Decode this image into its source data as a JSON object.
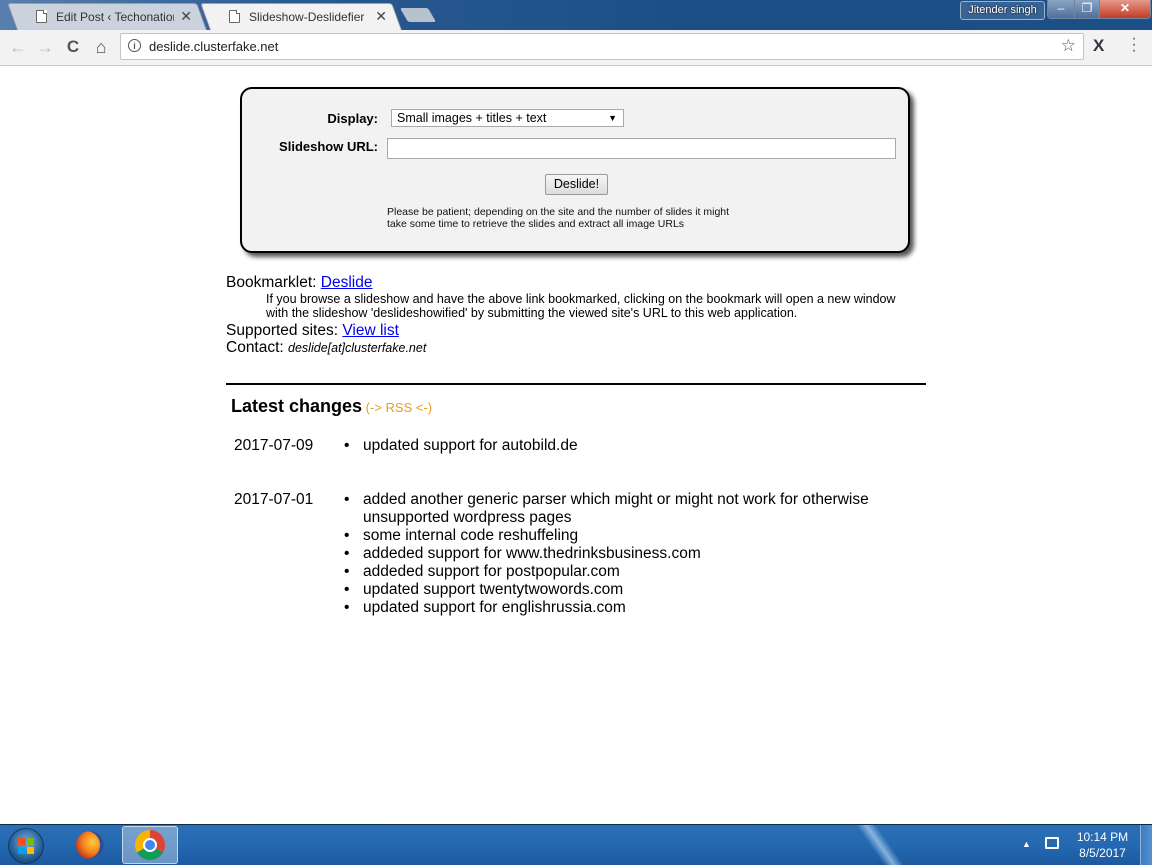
{
  "browser": {
    "tabs": [
      {
        "title": "Edit Post ‹ Techonation –",
        "active": false
      },
      {
        "title": "Slideshow-Deslidefier",
        "active": true
      }
    ],
    "user_name": "Jitender singh",
    "window_controls": {
      "minimize": "–",
      "maximize": "❐",
      "close": "✕"
    },
    "nav": {
      "back": "←",
      "forward": "→",
      "reload": "C",
      "home": "⌂"
    },
    "address": {
      "url": "deslide.clusterfake.net",
      "info_icon": "i",
      "star_icon": "☆"
    },
    "extension_icon": "X",
    "menu_icon": "⋮"
  },
  "form": {
    "display_label": "Display:",
    "display_selected": "Small images + titles + text",
    "url_label": "Slideshow URL:",
    "url_value": "",
    "submit_label": "Deslide!",
    "hint_line1": "Please be patient; depending on the site and the number of slides it might",
    "hint_line2": "take some time to retrieve the slides and extract all image URLs"
  },
  "info": {
    "bookmarklet_label": "Bookmarklet: ",
    "bookmarklet_link": "Deslide",
    "bookmarklet_desc_line1": "If you browse a slideshow and have the above link bookmarked, clicking on the bookmark will open a new window",
    "bookmarklet_desc_line2": "with the slideshow 'deslideshowified' by submitting the viewed site's URL to this web application.",
    "supported_label": "Supported sites: ",
    "supported_link": "View list",
    "contact_label": "Contact: ",
    "contact_value": "deslide[at]clusterfake.net"
  },
  "changes": {
    "title": "Latest changes",
    "rss_open": " (",
    "rss_link": "-> RSS <-",
    "rss_close": ")",
    "groups": [
      {
        "date": "2017-07-09",
        "items": [
          "updated support for autobild.de"
        ]
      },
      {
        "date": "2017-07-01",
        "items": [
          "added another generic parser which might or might not work for otherwise unsupported wordpress pages",
          "some internal code reshuffeling",
          "addeded support for www.thedrinksbusiness.com",
          "addeded support for postpopular.com",
          "updated support twentytwowords.com",
          "updated support for englishrussia.com"
        ]
      }
    ]
  },
  "taskbar": {
    "time": "10:14 PM",
    "date": "8/5/2017",
    "tray_arrow": "▲"
  }
}
